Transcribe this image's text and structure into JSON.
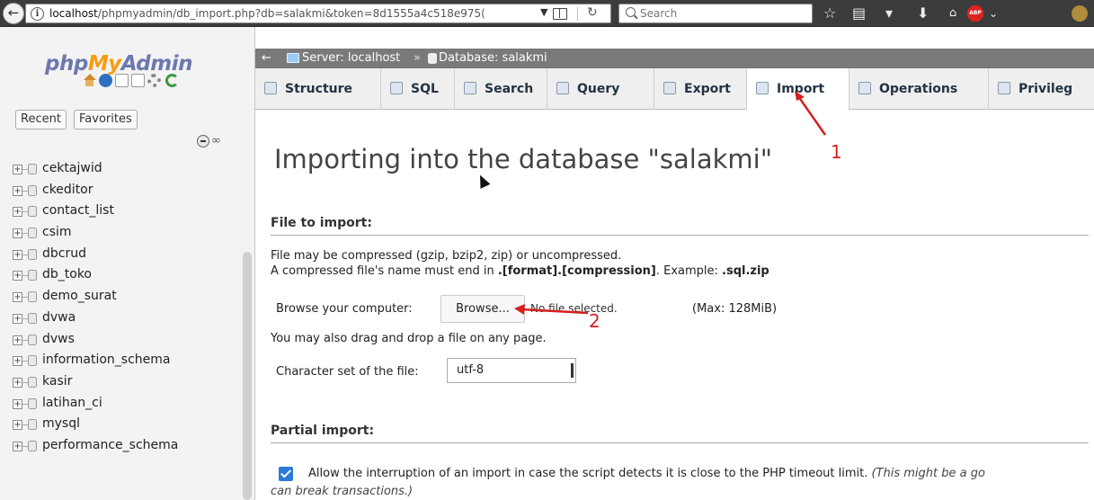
{
  "browser": {
    "url_host": "localhost",
    "url_path": "/phpmyadmin/db_import.php?db=salakmi&token=8d1555a4c518e975(",
    "search_placeholder": "Search"
  },
  "logo": {
    "part1": "php",
    "part2": "My",
    "part3": "Admin"
  },
  "nav": {
    "recent_label": "Recent",
    "favorites_label": "Favorites",
    "databases": [
      "cektajwid",
      "ckeditor",
      "contact_list",
      "csim",
      "dbcrud",
      "db_toko",
      "demo_surat",
      "dvwa",
      "dvws",
      "information_schema",
      "kasir",
      "latihan_ci",
      "mysql",
      "performance_schema"
    ]
  },
  "breadcrumb": {
    "server": "Server: localhost",
    "separator": "»",
    "database": "Database: salakmi"
  },
  "tabs": [
    {
      "label": "Structure"
    },
    {
      "label": "SQL"
    },
    {
      "label": "Search"
    },
    {
      "label": "Query"
    },
    {
      "label": "Export"
    },
    {
      "label": "Import"
    },
    {
      "label": "Operations"
    },
    {
      "label": "Privileg"
    }
  ],
  "main": {
    "title": "Importing into the database \"salakmi\"",
    "file_section": "File to import:",
    "compress_line1": "File may be compressed (gzip, bzip2, zip) or uncompressed.",
    "compress_line2_prefix": "A compressed file's name must end in ",
    "compress_line2_format": ".[format].[compression]",
    "compress_line2_mid": ". Example: ",
    "compress_line2_example": ".sql.zip",
    "browse_label": "Browse your computer:",
    "browse_button": "Browse...",
    "no_file": "No file selected.",
    "max_size": "(Max: 128MiB)",
    "drag_drop": "You may also drag and drop a file on any page.",
    "charset_label": "Character set of the file:",
    "charset_value": "utf-8",
    "partial_section": "Partial import:",
    "allow_text": "Allow the interruption of an import in case the script detects it is close to the PHP timeout limit. ",
    "allow_note": "(This might be a go",
    "allow_cont": "can break transactions.)"
  },
  "annotations": {
    "num1": "1",
    "num2": "2"
  },
  "colors": {
    "accent": "#2c7ad6",
    "annotation": "#d61f1f",
    "logo_blue": "#6c78af",
    "logo_orange": "#f89c0e"
  }
}
